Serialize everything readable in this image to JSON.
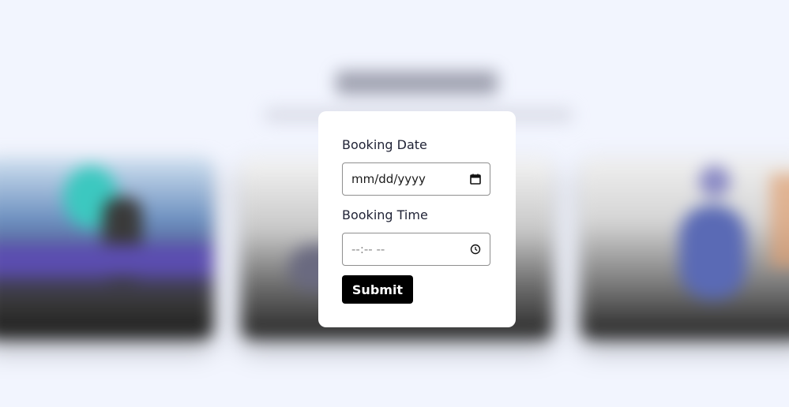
{
  "form": {
    "date_label": "Booking Date",
    "date_value": "mm/dd/yyyy",
    "date_icon": "calendar-icon",
    "time_label": "Booking Time",
    "time_value": "--:-- --",
    "time_icon": "clock-icon",
    "submit_label": "Submit"
  },
  "colors": {
    "page_background": "#f2f5fe",
    "modal_background": "#ffffff",
    "button_background": "#000000",
    "button_text": "#ffffff",
    "input_border": "#8f8f8f"
  }
}
